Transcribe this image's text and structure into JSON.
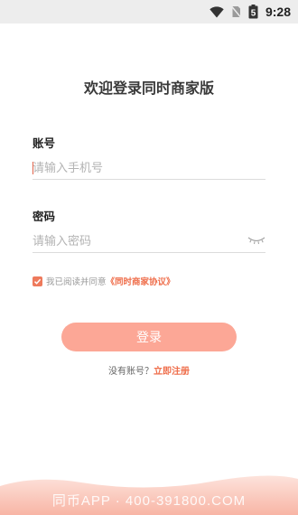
{
  "status_bar": {
    "time": "9:28",
    "battery_level": "5"
  },
  "title": "欢迎登录同时商家版",
  "account": {
    "label": "账号",
    "placeholder": "请输入手机号"
  },
  "password": {
    "label": "密码",
    "placeholder": "请输入密码"
  },
  "agreement": {
    "checked": true,
    "prefix": "我已阅读并同意",
    "link": "《同时商家协议》"
  },
  "login_button": {
    "label": "登录"
  },
  "register": {
    "prompt": "没有账号？",
    "link": "立即注册"
  },
  "footer": {
    "watermark": "同币APP · 400-391800.COM"
  },
  "colors": {
    "accent": "#ef6e4b",
    "button": "#fca796",
    "checkbox": "#ee7a5c"
  }
}
